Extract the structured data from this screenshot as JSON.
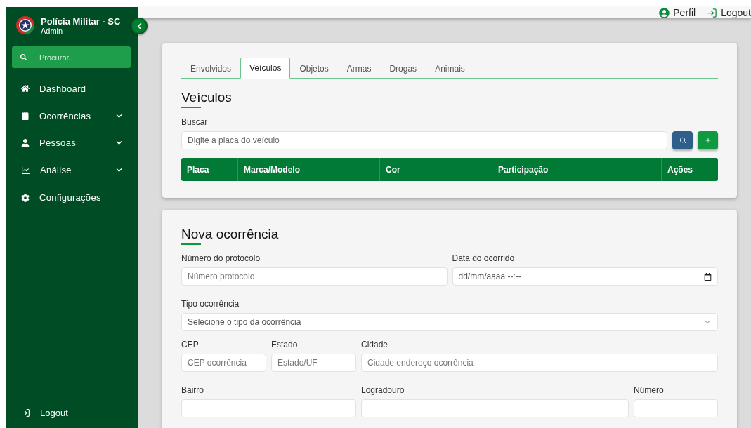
{
  "sidebar": {
    "title": "Polícia Militar - SC",
    "subtitle": "Admin",
    "search": {
      "placeholder": "Procurar..."
    },
    "items": [
      {
        "label": "Dashboard",
        "has_submenu": false
      },
      {
        "label": "Ocorrências",
        "has_submenu": true
      },
      {
        "label": "Pessoas",
        "has_submenu": true
      },
      {
        "label": "Análise",
        "has_submenu": true
      },
      {
        "label": "Configurações",
        "has_submenu": false
      }
    ],
    "logout": "Logout"
  },
  "topbar": {
    "links": [
      "Perfil",
      "Logout"
    ]
  },
  "vehicles_card": {
    "tabs": [
      {
        "label": "Envolvidos",
        "selected": false
      },
      {
        "label": "Veículos",
        "selected": true
      },
      {
        "label": "Objetos",
        "selected": false
      },
      {
        "label": "Armas",
        "selected": false
      },
      {
        "label": "Drogas",
        "selected": false
      },
      {
        "label": "Animais",
        "selected": false
      }
    ],
    "heading": "Veículos",
    "search_label": "Buscar",
    "search": {
      "placeholder": "Digite a placa do veículo"
    },
    "table": {
      "columns": [
        "Placa",
        "Marca/Modelo",
        "Cor",
        "Participação",
        "Ações"
      ]
    }
  },
  "form_card": {
    "heading": "Nova ocorrência",
    "fields": [
      {
        "label": "Número do protocolo",
        "kind": "text",
        "placeholder": "Número protocolo"
      },
      {
        "label": "Data do ocorrido",
        "kind": "date",
        "value": "dd/mm/aaaa --:--"
      },
      {
        "label": "Tipo ocorrência",
        "kind": "select",
        "placeholder": "Selecione o tipo da ocorrência"
      },
      {
        "label": "CEP",
        "kind": "text",
        "placeholder": "CEP ocorrência"
      },
      {
        "label": "Estado",
        "kind": "text",
        "placeholder": "Estado/UF"
      },
      {
        "label": "Cidade",
        "kind": "text",
        "placeholder": "Cidade endereço ocorrência"
      },
      {
        "label": "Bairro",
        "kind": "text"
      },
      {
        "label": "Logradouro",
        "kind": "text"
      },
      {
        "label": "Número",
        "kind": "text"
      }
    ]
  }
}
